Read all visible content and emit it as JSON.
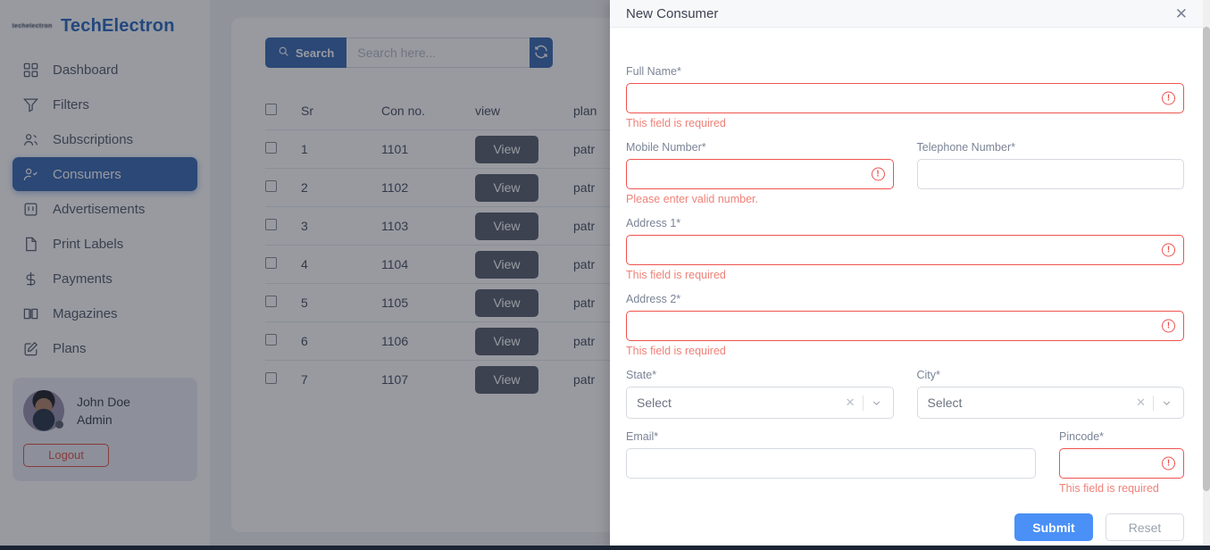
{
  "brand": {
    "logo_alt": "techelectron-logo-mark",
    "name": "TechElectron"
  },
  "sidebar": {
    "items": [
      {
        "label": "Dashboard",
        "icon": "grid-icon",
        "active": false
      },
      {
        "label": "Filters",
        "icon": "funnel-icon",
        "active": false
      },
      {
        "label": "Subscriptions",
        "icon": "users-icon",
        "active": false
      },
      {
        "label": "Consumers",
        "icon": "user-check-icon",
        "active": true
      },
      {
        "label": "Advertisements",
        "icon": "billboard-icon",
        "active": false
      },
      {
        "label": "Print Labels",
        "icon": "document-icon",
        "active": false
      },
      {
        "label": "Payments",
        "icon": "dollar-icon",
        "active": false
      },
      {
        "label": "Magazines",
        "icon": "book-icon",
        "active": false
      },
      {
        "label": "Plans",
        "icon": "edit-square-icon",
        "active": false
      }
    ],
    "profile": {
      "name": "John Doe",
      "role": "Admin",
      "logout_label": "Logout"
    }
  },
  "toolbar": {
    "search_button_label": "Search",
    "search_placeholder": "Search here...",
    "search_value": "",
    "refresh_label": "refresh"
  },
  "table": {
    "headers": [
      "",
      "Sr",
      "Con no.",
      "view",
      "plan"
    ],
    "rows": [
      {
        "sr": "1",
        "con_no": "1101",
        "view_label": "View",
        "plan": "patr"
      },
      {
        "sr": "2",
        "con_no": "1102",
        "view_label": "View",
        "plan": "patr"
      },
      {
        "sr": "3",
        "con_no": "1103",
        "view_label": "View",
        "plan": "patr"
      },
      {
        "sr": "4",
        "con_no": "1104",
        "view_label": "View",
        "plan": "patr"
      },
      {
        "sr": "5",
        "con_no": "1105",
        "view_label": "View",
        "plan": "patr"
      },
      {
        "sr": "6",
        "con_no": "1106",
        "view_label": "View",
        "plan": "patr"
      },
      {
        "sr": "7",
        "con_no": "1107",
        "view_label": "View",
        "plan": "patr"
      }
    ]
  },
  "modal": {
    "title": "New Consumer",
    "close_label": "✕",
    "fields": {
      "full_name": {
        "label": "Full Name*",
        "value": "",
        "error": "This field is required"
      },
      "mobile": {
        "label": "Mobile Number*",
        "value": "",
        "error": "Please enter valid number."
      },
      "telephone": {
        "label": "Telephone Number*",
        "value": "",
        "error": ""
      },
      "address1": {
        "label": "Address 1*",
        "value": "",
        "error": "This field is required"
      },
      "address2": {
        "label": "Address 2*",
        "value": "",
        "error": "This field is required"
      },
      "state": {
        "label": "State*",
        "value": "Select"
      },
      "city": {
        "label": "City*",
        "value": "Select"
      },
      "email": {
        "label": "Email*",
        "value": "",
        "error": ""
      },
      "pincode": {
        "label": "Pincode*",
        "value": "",
        "error": "This field is required"
      }
    },
    "submit_label": "Submit",
    "reset_label": "Reset"
  },
  "colors": {
    "brand_blue": "#2f6cc0",
    "sidebar_active": "#3e6db5",
    "error_red": "#ef5350",
    "submit_blue": "#4a90f7",
    "logout_red": "#e2574c"
  }
}
